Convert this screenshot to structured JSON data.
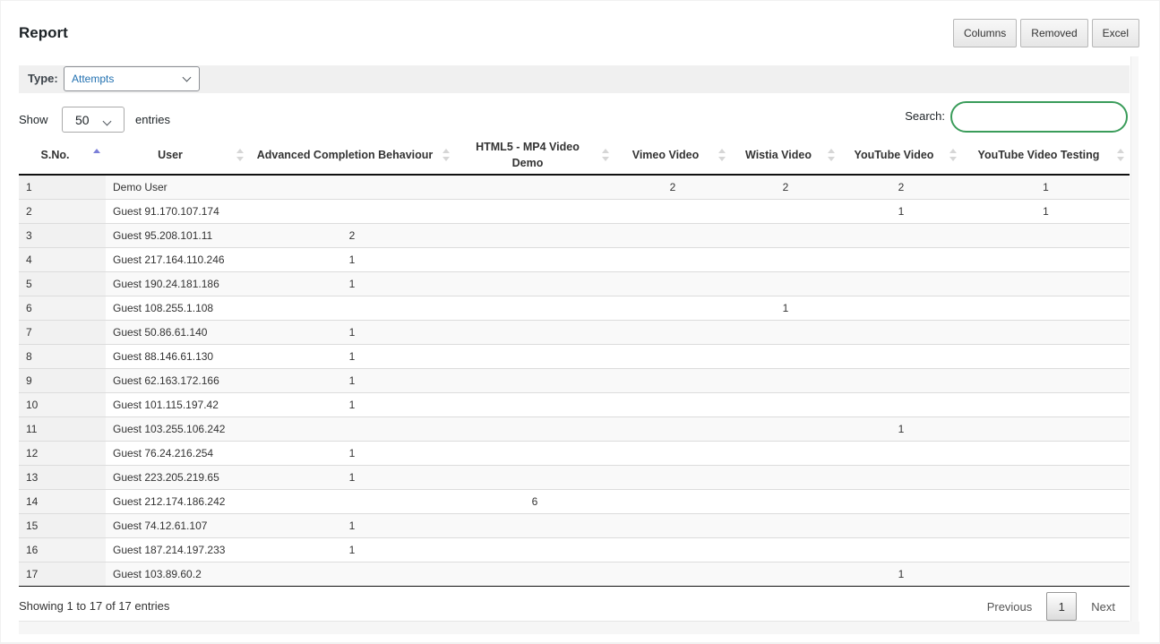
{
  "header": {
    "title": "Report",
    "buttons": [
      "Columns",
      "Removed",
      "Excel"
    ]
  },
  "type_filter": {
    "label": "Type:",
    "selected": "Attempts"
  },
  "length_menu": {
    "show_label": "Show",
    "selected": "50",
    "entries_label": "entries"
  },
  "search": {
    "label": "Search:",
    "value": "",
    "accent_color": "#3a9c5a"
  },
  "table": {
    "columns": [
      "S.No.",
      "User",
      "Advanced Completion Behaviour",
      "HTML5 - MP4 Video Demo",
      "Vimeo Video",
      "Wistia Video",
      "YouTube Video",
      "YouTube Video Testing"
    ],
    "sorted_column": "S.No.",
    "sort_direction": "ascending",
    "rows": [
      [
        "1",
        "Demo User",
        "",
        "",
        "2",
        "2",
        "2",
        "1"
      ],
      [
        "2",
        "Guest 91.170.107.174",
        "",
        "",
        "",
        "",
        "1",
        "1"
      ],
      [
        "3",
        "Guest 95.208.101.11",
        "2",
        "",
        "",
        "",
        "",
        ""
      ],
      [
        "4",
        "Guest 217.164.110.246",
        "1",
        "",
        "",
        "",
        "",
        ""
      ],
      [
        "5",
        "Guest 190.24.181.186",
        "1",
        "",
        "",
        "",
        "",
        ""
      ],
      [
        "6",
        "Guest 108.255.1.108",
        "",
        "",
        "",
        "1",
        "",
        ""
      ],
      [
        "7",
        "Guest 50.86.61.140",
        "1",
        "",
        "",
        "",
        "",
        ""
      ],
      [
        "8",
        "Guest 88.146.61.130",
        "1",
        "",
        "",
        "",
        "",
        ""
      ],
      [
        "9",
        "Guest 62.163.172.166",
        "1",
        "",
        "",
        "",
        "",
        ""
      ],
      [
        "10",
        "Guest 101.115.197.42",
        "1",
        "",
        "",
        "",
        "",
        ""
      ],
      [
        "11",
        "Guest 103.255.106.242",
        "",
        "",
        "",
        "",
        "1",
        ""
      ],
      [
        "12",
        "Guest 76.24.216.254",
        "1",
        "",
        "",
        "",
        "",
        ""
      ],
      [
        "13",
        "Guest 223.205.219.65",
        "1",
        "",
        "",
        "",
        "",
        ""
      ],
      [
        "14",
        "Guest 212.174.186.242",
        "",
        "6",
        "",
        "",
        "",
        ""
      ],
      [
        "15",
        "Guest 74.12.61.107",
        "1",
        "",
        "",
        "",
        "",
        ""
      ],
      [
        "16",
        "Guest 187.214.197.233",
        "1",
        "",
        "",
        "",
        "",
        ""
      ],
      [
        "17",
        "Guest 103.89.60.2",
        "",
        "",
        "",
        "",
        "1",
        ""
      ]
    ]
  },
  "footer": {
    "info": "Showing 1 to 17 of 17 entries",
    "previous": "Previous",
    "current_page": "1",
    "next": "Next"
  },
  "colors": {
    "sort_active": "#7b7fd8",
    "select_text": "#2271b1"
  }
}
